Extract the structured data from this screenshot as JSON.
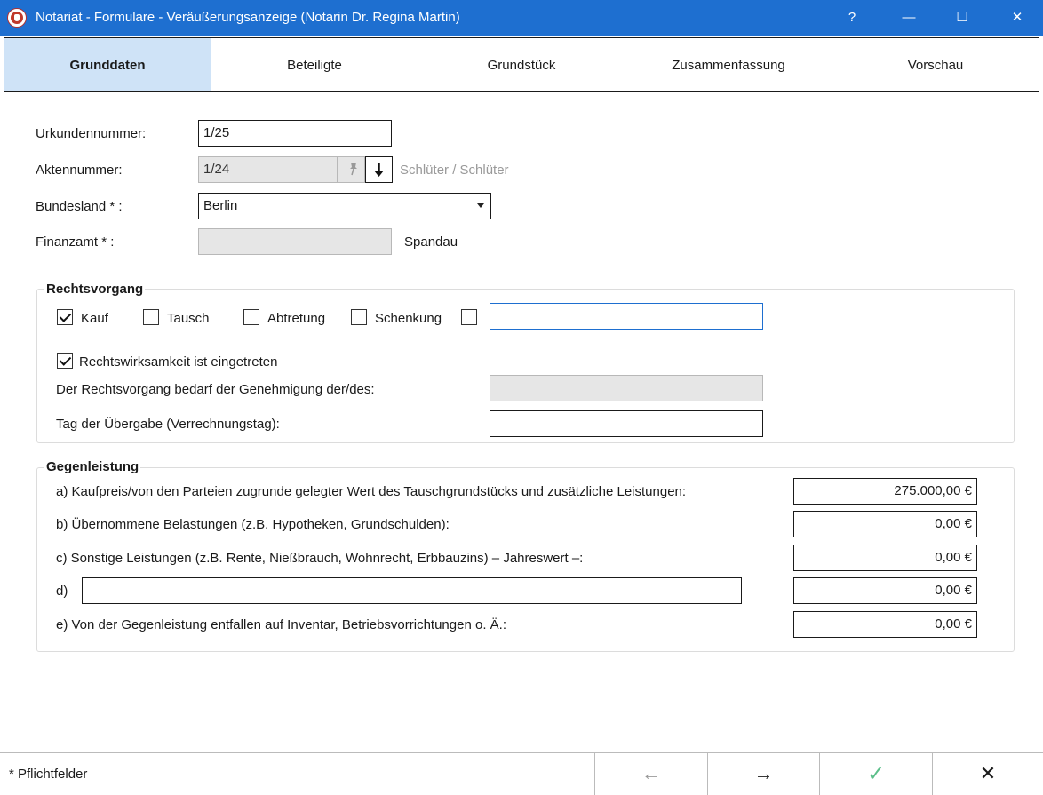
{
  "window": {
    "title": "Notariat - Formulare - Veräußerungsanzeige (Notarin Dr. Regina Martin)",
    "help": "?",
    "minimize": "—",
    "maximize": "☐",
    "close": "✕"
  },
  "tabs": [
    {
      "label": "Grunddaten",
      "active": true
    },
    {
      "label": "Beteiligte",
      "active": false
    },
    {
      "label": "Grundstück",
      "active": false
    },
    {
      "label": "Zusammenfassung",
      "active": false
    },
    {
      "label": "Vorschau",
      "active": false
    }
  ],
  "grunddaten": {
    "urkundennummer_label": "Urkundennummer:",
    "urkundennummer_value": "1/25",
    "aktennummer_label": "Aktennummer:",
    "aktennummer_value": "1/24",
    "aktennummer_hint": "Schlüter / Schlüter",
    "bundesland_label": "Bundesland * :",
    "bundesland_value": "Berlin",
    "finanzamt_label": "Finanzamt * :",
    "finanzamt_value": "",
    "finanzamt_name": "Spandau"
  },
  "rechtsvorgang": {
    "title": "Rechtsvorgang",
    "options": [
      {
        "label": "Kauf",
        "checked": true
      },
      {
        "label": "Tausch",
        "checked": false
      },
      {
        "label": "Abtretung",
        "checked": false
      },
      {
        "label": "Schenkung",
        "checked": false
      }
    ],
    "other_value": "",
    "rechtswirksamkeit_label": "Rechtswirksamkeit ist eingetreten",
    "rechtswirksamkeit_checked": true,
    "genehmigung_label": "Der Rechtsvorgang bedarf der Genehmigung der/des:",
    "genehmigung_value": "",
    "uebergabe_label": "Tag der Übergabe (Verrechnungstag):",
    "uebergabe_value": ""
  },
  "gegenleistung": {
    "title": "Gegenleistung",
    "rows": [
      {
        "label": "a) Kaufpreis/von den Parteien zugrunde gelegter Wert des Tauschgrundstücks und zusätzliche Leistungen:",
        "value": "275.000,00 €"
      },
      {
        "label": "b) Übernommene Belastungen (z.B. Hypotheken, Grundschulden):",
        "value": "0,00 €"
      },
      {
        "label": "c) Sonstige Leistungen (z.B. Rente, Nießbrauch, Wohnrecht, Erbbauzins) – Jahreswert –:",
        "value": "0,00 €"
      },
      {
        "label": "d)",
        "text_value": "",
        "value": "0,00 €"
      },
      {
        "label": "e) Von der Gegenleistung entfallen auf Inventar, Betriebsvorrichtungen o. Ä.:",
        "value": "0,00 €"
      }
    ]
  },
  "footer": {
    "note": "* Pflichtfelder",
    "back": "←",
    "forward": "→",
    "ok": "✓",
    "cancel": "✕"
  },
  "colors": {
    "titlebar": "#1e6fd0",
    "active_tab": "#cfe3f7",
    "focus_border": "#1e6fd0",
    "ok_check": "#5cbf8a"
  }
}
